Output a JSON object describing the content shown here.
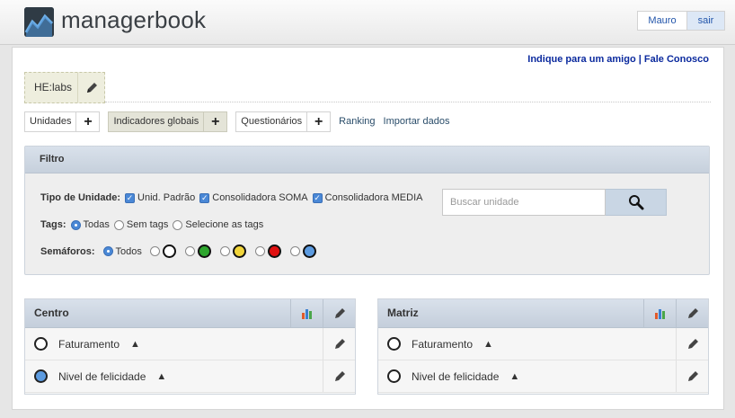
{
  "header": {
    "brand": "managerbook",
    "user": "Mauro",
    "logout": "sair"
  },
  "top_links": {
    "invite": "Indique para um amigo",
    "separator": "|",
    "contact": "Fale Conosco"
  },
  "company": {
    "name": "HE:labs",
    "edit_icon": "pencil-icon"
  },
  "tabs": [
    {
      "label": "Unidades",
      "plus": "+"
    },
    {
      "label": "Indicadores globais",
      "plus": "+"
    },
    {
      "label": "Questionários",
      "plus": "+"
    }
  ],
  "tab_links": [
    "Ranking",
    "Importar dados"
  ],
  "filter": {
    "title": "Filtro",
    "unit_type": {
      "label": "Tipo de Unidade:",
      "options": [
        "Unid. Padrão",
        "Consolidadora SOMA",
        "Consolidadora MEDIA"
      ]
    },
    "tags": {
      "label": "Tags:",
      "options": [
        "Todas",
        "Sem tags",
        "Selecione as tags"
      ]
    },
    "semaforos": {
      "label": "Semáforos:",
      "all_label": "Todos",
      "colors": [
        "#ffffff",
        "#2ea62e",
        "#f0d43a",
        "#e01010",
        "#5c9be0"
      ]
    },
    "search": {
      "placeholder": "Buscar unidade",
      "icon": "search-icon"
    }
  },
  "panels": [
    {
      "title": "Centro",
      "rows": [
        {
          "label": "Faturamento",
          "arrow": "▲",
          "status_color": "#ffffff"
        },
        {
          "label": "Nivel de felicidade",
          "arrow": "▲",
          "status_color": "#5c9be0"
        }
      ]
    },
    {
      "title": "Matriz",
      "rows": [
        {
          "label": "Faturamento",
          "arrow": "▲",
          "status_color": "#ffffff"
        },
        {
          "label": "Nivel de felicidade",
          "arrow": "▲",
          "status_color": "#ffffff"
        }
      ]
    }
  ],
  "colors": {
    "accent_blue": "#4a88d6",
    "link_blue": "#0b2a9e"
  }
}
